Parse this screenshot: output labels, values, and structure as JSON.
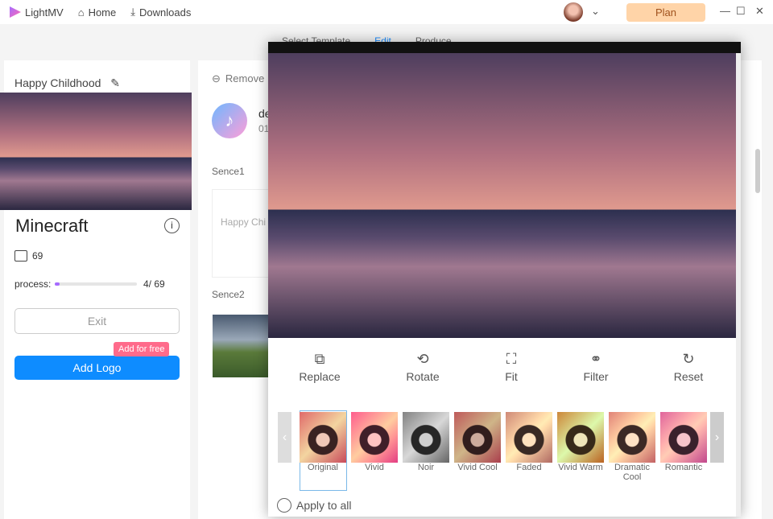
{
  "topbar": {
    "app": "LightMV",
    "home": "Home",
    "downloads": "Downloads",
    "plan": "Plan"
  },
  "breadcrumb": [
    "Select Template",
    "Edit",
    "Produce"
  ],
  "left": {
    "title": "Happy Childhood",
    "template": "Minecraft",
    "count": "69",
    "process_label": "process:",
    "process_text": "4/ 69",
    "progress": 0.058,
    "exit": "Exit",
    "add_logo": "Add Logo",
    "badge": "Add for free"
  },
  "mid": {
    "remove": "Remove",
    "music_name": "de",
    "music_time": "01",
    "scene1": "Sence1",
    "scene1_text": "Happy Chi",
    "scene2": "Sence2"
  },
  "dialog": {
    "tools": [
      "Replace",
      "Rotate",
      "Fit",
      "Filter",
      "Reset"
    ],
    "filters": [
      "Original",
      "Vivid",
      "Noir",
      "Vivid Cool",
      "Faded",
      "Vivid Warm",
      "Dramatic Cool",
      "Romantic"
    ],
    "selected_filter": "Original",
    "apply_all": "Apply to all"
  }
}
